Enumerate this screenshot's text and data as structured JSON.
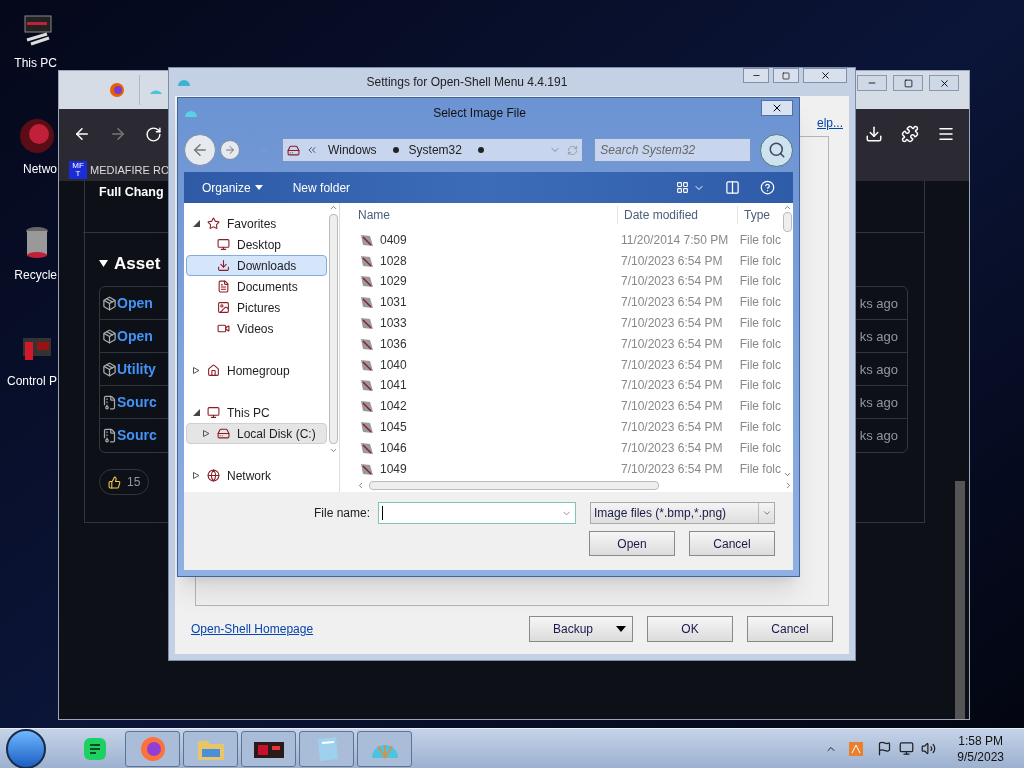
{
  "desktop_icons": [
    {
      "label": "This PC",
      "kind": "pc"
    },
    {
      "label": "Netwo",
      "kind": "network"
    },
    {
      "label": "Recycle",
      "kind": "recycle"
    },
    {
      "label": "Control P",
      "kind": "control"
    }
  ],
  "browser": {
    "bookmark": {
      "favicon_lines": [
        "MF",
        "T"
      ],
      "label": "MEDIAFIRE RO"
    },
    "heading": "Full Chang",
    "section": {
      "title": "Asset",
      "expanded": true
    },
    "assets": [
      {
        "kind": "package",
        "name": "Open",
        "age": "ks ago"
      },
      {
        "kind": "package",
        "name": "Open",
        "age": "ks ago"
      },
      {
        "kind": "package",
        "name": "Utility",
        "age": "ks ago"
      },
      {
        "kind": "zip",
        "name": "Sourc",
        "age": "ks ago"
      },
      {
        "kind": "zip",
        "name": "Sourc",
        "age": "ks ago"
      }
    ],
    "reactions": [
      {
        "kind": "thumbs-up",
        "count": "15"
      }
    ]
  },
  "settings": {
    "title": "Settings for Open-Shell Menu 4.4.191",
    "help_link": "elp...",
    "homepage_link": "Open-Shell Homepage",
    "buttons": [
      {
        "label": "Backup",
        "kind": "split"
      },
      {
        "label": "OK",
        "kind": "plain"
      },
      {
        "label": "Cancel",
        "kind": "plain"
      }
    ]
  },
  "dialog": {
    "title": "Select Image File",
    "breadcrumb": [
      "Windows",
      "System32"
    ],
    "search": {
      "placeholder": "Search System32"
    },
    "toolbar": [
      {
        "label": "Organize",
        "kind": "menu"
      },
      {
        "label": "New folder",
        "kind": "plain"
      }
    ],
    "nav": [
      {
        "label": "Favorites",
        "expanded": true,
        "selected": false,
        "hovered": false,
        "children": [
          {
            "label": "Desktop",
            "selected": false,
            "hovered": false
          },
          {
            "label": "Downloads",
            "selected": false,
            "hovered": true
          },
          {
            "label": "Documents",
            "selected": false,
            "hovered": false
          },
          {
            "label": "Pictures",
            "selected": false,
            "hovered": false
          },
          {
            "label": "Videos",
            "selected": false,
            "hovered": false
          }
        ]
      },
      {
        "label": "Homegroup",
        "expanded": false,
        "selected": false,
        "hovered": false
      },
      {
        "label": "This PC",
        "expanded": true,
        "selected": false,
        "hovered": false,
        "children": [
          {
            "label": "Local Disk (C:)",
            "expanded": false,
            "selected": true,
            "hovered": false
          }
        ]
      },
      {
        "label": "Network",
        "expanded": false,
        "selected": false,
        "hovered": false
      }
    ],
    "columns": [
      "Name",
      "Date modified",
      "Type"
    ],
    "rows": [
      {
        "name": "0409",
        "date": "11/20/2014 7:50 PM",
        "type": "File folc"
      },
      {
        "name": "1028",
        "date": "7/10/2023 6:54 PM",
        "type": "File folc"
      },
      {
        "name": "1029",
        "date": "7/10/2023 6:54 PM",
        "type": "File folc"
      },
      {
        "name": "1031",
        "date": "7/10/2023 6:54 PM",
        "type": "File folc"
      },
      {
        "name": "1033",
        "date": "7/10/2023 6:54 PM",
        "type": "File folc"
      },
      {
        "name": "1036",
        "date": "7/10/2023 6:54 PM",
        "type": "File folc"
      },
      {
        "name": "1040",
        "date": "7/10/2023 6:54 PM",
        "type": "File folc"
      },
      {
        "name": "1041",
        "date": "7/10/2023 6:54 PM",
        "type": "File folc"
      },
      {
        "name": "1042",
        "date": "7/10/2023 6:54 PM",
        "type": "File folc"
      },
      {
        "name": "1045",
        "date": "7/10/2023 6:54 PM",
        "type": "File folc"
      },
      {
        "name": "1046",
        "date": "7/10/2023 6:54 PM",
        "type": "File folc"
      },
      {
        "name": "1049",
        "date": "7/10/2023 6:54 PM",
        "type": "File folc"
      }
    ],
    "file_name_label": "File name:",
    "filter": "Image files (*.bmp,*.png)",
    "buttons": [
      "Open",
      "Cancel"
    ]
  },
  "taskbar": {
    "apps": [
      {
        "kind": "notes",
        "running": false
      },
      {
        "kind": "firefox",
        "running": true
      },
      {
        "kind": "explorer",
        "running": true
      },
      {
        "kind": "game",
        "running": true
      },
      {
        "kind": "notepad",
        "running": true
      },
      {
        "kind": "shell",
        "running": true
      }
    ],
    "time": "1:58 PM",
    "date": "9/5/2023"
  }
}
